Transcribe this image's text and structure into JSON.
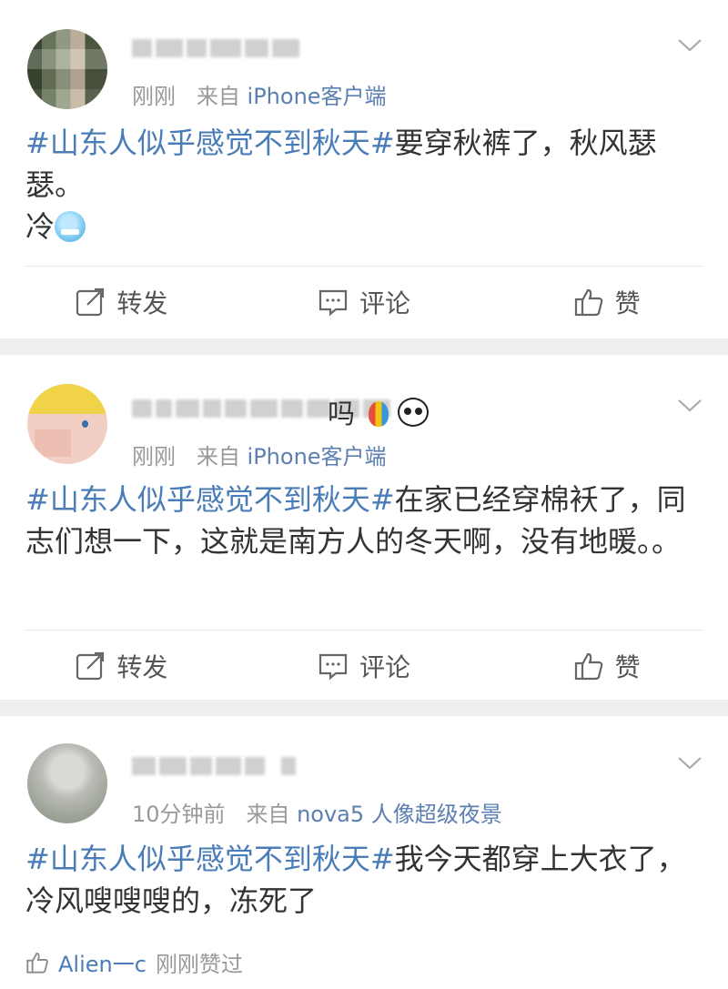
{
  "posts": [
    {
      "time": "刚刚",
      "source_prefix": "来自",
      "source": "iPhone客户端",
      "topic": "#山东人似乎感觉不到秋天#",
      "text": "要穿秋裤了，秋风瑟瑟。",
      "text_line2": "冷",
      "actions": {
        "repost": "转发",
        "comment": "评论",
        "like": "赞"
      }
    },
    {
      "name_tail": "吗",
      "time": "刚刚",
      "source_prefix": "来自",
      "source": "iPhone客户端",
      "topic": "#山东人似乎感觉不到秋天#",
      "text": "在家已经穿棉袄了，同志们想一下，这就是南方人的冬天啊，没有地暖。。",
      "actions": {
        "repost": "转发",
        "comment": "评论",
        "like": "赞"
      }
    },
    {
      "time": "10分钟前",
      "source_prefix": "来自",
      "source": "nova5 人像超级夜景",
      "topic": "#山东人似乎感觉不到秋天#",
      "text": "我今天都穿上大衣了，冷风嗖嗖嗖的，冻死了",
      "liked_user": "Alien一c",
      "liked_text": "刚刚赞过"
    }
  ],
  "colors": {
    "link": "#4a7db8",
    "meta": "#999999",
    "separator": "#eeeeee"
  },
  "icons": [
    "chevron-down-icon",
    "repost-icon",
    "comment-icon",
    "like-icon",
    "cold-face-emoji",
    "balloon-emoji",
    "panda-emoji"
  ]
}
